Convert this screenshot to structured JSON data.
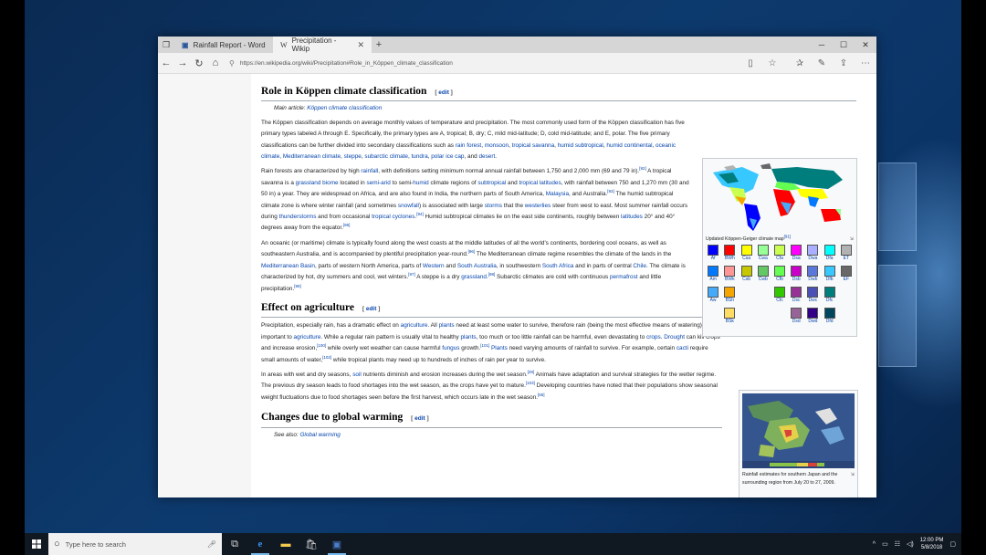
{
  "browser": {
    "tabs": [
      {
        "label": "Rainfall Report - Word",
        "icon": "word-icon"
      },
      {
        "label": "Precipitation - Wikip",
        "icon": "wikipedia-icon",
        "active": true
      }
    ],
    "url": "https://en.wikipedia.org/wiki/Precipitation#Role_in_Köppen_climate_classification"
  },
  "article": {
    "s1": {
      "title": "Role in Köppen climate classification",
      "edit": "edit",
      "hatnote_prefix": "Main article:",
      "hatnote_link": "Köppen climate classification",
      "p1": [
        "The Köppen classification depends on average monthly values of temperature and precipitation. The most commonly used form of the Köppen classification has five primary types labeled A through E. Specifically, the primary types are A, tropical; B, dry; C, mild mid-latitude; D, cold mid-latitude; and E, polar. The five primary classifications can be further divided into secondary classifications such as ",
        {
          "link": "rain forest"
        },
        ", ",
        {
          "link": "monsoon"
        },
        ", ",
        {
          "link": "tropical savanna"
        },
        ", ",
        {
          "link": "humid subtropical"
        },
        ", ",
        {
          "link": "humid continental"
        },
        ", ",
        {
          "link": "oceanic climate"
        },
        ", ",
        {
          "link": "Mediterranean climate"
        },
        ", ",
        {
          "link": "steppe"
        },
        ", ",
        {
          "link": "subarctic climate"
        },
        ", ",
        {
          "link": "tundra"
        },
        ", ",
        {
          "link": "polar ice cap"
        },
        ", and ",
        {
          "link": "desert"
        },
        "."
      ],
      "p2": [
        "Rain forests are characterized by high ",
        {
          "link": "rainfall"
        },
        ", with definitions setting minimum normal annual rainfall between 1,750 and 2,000 mm (69 and 79 in).",
        {
          "sup": "[92]"
        },
        " A tropical savanna is a ",
        {
          "link": "grassland"
        },
        " ",
        {
          "link": "biome"
        },
        " located in ",
        {
          "link": "semi-arid"
        },
        " to semi-",
        {
          "link": "humid"
        },
        " climate regions of ",
        {
          "link": "subtropical"
        },
        " and ",
        {
          "link": "tropical latitudes"
        },
        ", with rainfall between 750 and 1,270 mm (30 and 50 in) a year. They are widespread on Africa, and are also found in India, the northern parts of South America, ",
        {
          "link": "Malaysia"
        },
        ", and Australia.",
        {
          "sup": "[93]"
        },
        " The humid subtropical climate zone is where winter rainfall (and sometimes ",
        {
          "link": "snowfall"
        },
        ") is associated with large ",
        {
          "link": "storms"
        },
        " that the ",
        {
          "link": "westerlies"
        },
        " steer from west to east. Most summer rainfall occurs during ",
        {
          "link": "thunderstorms"
        },
        " and from occasional ",
        {
          "link": "tropical cyclones"
        },
        ".",
        {
          "sup": "[94]"
        },
        " Humid subtropical climates lie on the east side continents, roughly between ",
        {
          "link": "latitudes"
        },
        " 20° and 40° degrees away from the equator.",
        {
          "sup": "[95]"
        }
      ],
      "p3": [
        "An oceanic (or maritime) climate is typically found along the west coasts at the middle latitudes of all the world's continents, bordering cool oceans, as well as southeastern Australia, and is accompanied by plentiful precipitation year-round.",
        {
          "sup": "[96]"
        },
        " The Mediterranean climate regime resembles the climate of the lands in the ",
        {
          "link": "Mediterranean Basin"
        },
        ", parts of western North America, parts of ",
        {
          "link": "Western"
        },
        " and ",
        {
          "link": "South Australia"
        },
        ", in southwestern ",
        {
          "link": "South Africa"
        },
        " and in parts of central ",
        {
          "link": "Chile"
        },
        ". The climate is characterized by hot, dry summers and cool, wet winters.",
        {
          "sup": "[97]"
        },
        " A steppe is a dry ",
        {
          "link": "grassland"
        },
        ".",
        {
          "sup": "[98]"
        },
        " Subarctic climates are cold with continuous ",
        {
          "link": "permafrost"
        },
        " and little precipitation.",
        {
          "sup": "[99]"
        }
      ]
    },
    "s2": {
      "title": "Effect on agriculture",
      "edit": "edit",
      "p1": [
        "Precipitation, especially rain, has a dramatic effect on ",
        {
          "link": "agriculture"
        },
        ". All ",
        {
          "link": "plants"
        },
        " need at least some water to survive, therefore rain (being the most effective means of watering) is important to ",
        {
          "link": "agriculture"
        },
        ". While a regular rain pattern is usually vital to healthy ",
        {
          "link": "plants"
        },
        ", too much or too little rainfall can be harmful, even devastating to ",
        {
          "link": "crops"
        },
        ". ",
        {
          "link": "Drought"
        },
        " can kill crops and increase erosion,",
        {
          "sup": "[100]"
        },
        " while overly wet weather can cause harmful ",
        {
          "link": "fungus"
        },
        " growth.",
        {
          "sup": "[101]"
        },
        " ",
        {
          "link": "Plants"
        },
        " need varying amounts of rainfall to survive. For example, certain ",
        {
          "link": "cacti"
        },
        " require small amounts of water,",
        {
          "sup": "[102]"
        },
        " while tropical plants may need up to hundreds of inches of rain per year to survive."
      ],
      "p2": [
        "In areas with wet and dry seasons, ",
        {
          "link": "soil"
        },
        " nutrients diminish and erosion increases during the wet season.",
        {
          "sup": "[29]"
        },
        " Animals have adaptation and survival strategies for the wetter regime. The previous dry season leads to food shortages into the wet season, as the crops have yet to mature.",
        {
          "sup": "[103]"
        },
        " Developing countries have noted that their populations show seasonal weight fluctuations due to food shortages seen before the first harvest, which occurs late in the wet season.",
        {
          "sup": "[65]"
        }
      ]
    },
    "s3": {
      "title": "Changes due to global warming",
      "edit": "edit",
      "hatnote_prefix": "See also:",
      "hatnote_link": "Global warming"
    }
  },
  "koppen_thumb": {
    "caption": "Updated Köppen-Geiger climate map",
    "sup": "[91]",
    "legend": [
      {
        "code": "Af",
        "color": "#0000fe"
      },
      {
        "code": "BWh",
        "color": "#fe0000"
      },
      {
        "code": "Csa",
        "color": "#ffff00"
      },
      {
        "code": "Cwa",
        "color": "#96ff96"
      },
      {
        "code": "Cfa",
        "color": "#c8ff50"
      },
      {
        "code": "Dsa",
        "color": "#ff00ff"
      },
      {
        "code": "Dwa",
        "color": "#aaafff"
      },
      {
        "code": "Dfa",
        "color": "#00ffff"
      },
      {
        "code": "ET",
        "color": "#b2b2b2"
      },
      {
        "code": "Am",
        "color": "#0078ff"
      },
      {
        "code": "BWk",
        "color": "#ff9696"
      },
      {
        "code": "Csb",
        "color": "#c6c700"
      },
      {
        "code": "Cwb",
        "color": "#64c864"
      },
      {
        "code": "Cfb",
        "color": "#64ff50"
      },
      {
        "code": "Dsb",
        "color": "#c800c8"
      },
      {
        "code": "Dwb",
        "color": "#5a78dc"
      },
      {
        "code": "Dfb",
        "color": "#37c8ff"
      },
      {
        "code": "EF",
        "color": "#686868"
      },
      {
        "code": "Aw",
        "color": "#46aafa"
      },
      {
        "code": "BSh",
        "color": "#f5a500"
      },
      {
        "code": "Cfc",
        "color": "#32c800"
      },
      {
        "code": "Dsc",
        "color": "#963296"
      },
      {
        "code": "Dwc",
        "color": "#4b50b4"
      },
      {
        "code": "Dfc",
        "color": "#007d7d"
      },
      {
        "code": "BSk",
        "color": "#ffdc64"
      },
      {
        "code": "Dsd",
        "color": "#966496"
      },
      {
        "code": "Dwd",
        "color": "#320087"
      },
      {
        "code": "Dfd",
        "color": "#00465f"
      }
    ]
  },
  "rain_thumb": {
    "caption": "Rainfall estimates for southern Japan and the surrounding region from July 20 to 27, 2009."
  },
  "taskbar": {
    "search_placeholder": "Type here to search",
    "time": "12:00 PM",
    "date": "5/8/2018"
  }
}
